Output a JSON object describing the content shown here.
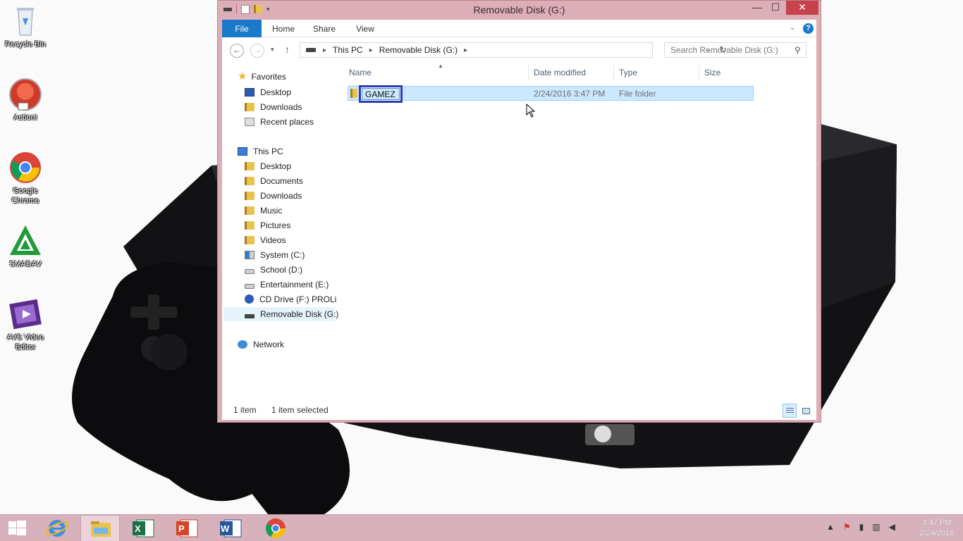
{
  "desktop": {
    "icons": [
      {
        "label": "Recycle Bin",
        "icon": "recycle-bin-icon"
      },
      {
        "label": "Action!",
        "icon": "action-icon"
      },
      {
        "label": "Google Chrome",
        "icon": "chrome-icon"
      },
      {
        "label": "SMADAV",
        "icon": "smadav-icon"
      },
      {
        "label": "AVS Video Editor",
        "icon": "avs-video-editor-icon"
      }
    ]
  },
  "window": {
    "title": "Removable Disk (G:)",
    "minimize": "—",
    "maximize": "☐",
    "close": "✕"
  },
  "ribbon": {
    "tabs": [
      "File",
      "Home",
      "Share",
      "View"
    ],
    "accent": "#1979ca"
  },
  "address": {
    "crumbs": [
      "This PC",
      "Removable Disk (G:)"
    ],
    "search_placeholder": "Search Removable Disk (G:)"
  },
  "navpane": {
    "favorites_label": "Favorites",
    "favorites": [
      {
        "label": "Desktop",
        "icon": "desktop"
      },
      {
        "label": "Downloads",
        "icon": "folder"
      },
      {
        "label": "Recent places",
        "icon": "recent"
      }
    ],
    "thispc_label": "This PC",
    "thispc": [
      {
        "label": "Desktop",
        "icon": "folder"
      },
      {
        "label": "Documents",
        "icon": "folder"
      },
      {
        "label": "Downloads",
        "icon": "folder"
      },
      {
        "label": "Music",
        "icon": "folder"
      },
      {
        "label": "Pictures",
        "icon": "folder"
      },
      {
        "label": "Videos",
        "icon": "folder"
      },
      {
        "label": "System (C:)",
        "icon": "sys"
      },
      {
        "label": "School (D:)",
        "icon": "drive"
      },
      {
        "label": "Entertainment (E:)",
        "icon": "drive"
      },
      {
        "label": "CD Drive (F:) PROLiN",
        "icon": "cd"
      },
      {
        "label": "Removable Disk (G:)",
        "icon": "usb",
        "selected": true
      }
    ],
    "network_label": "Network"
  },
  "list": {
    "columns": [
      "Name",
      "Date modified",
      "Type",
      "Size"
    ],
    "rows": [
      {
        "name": "GAMEZ",
        "date": "2/24/2016 3:47 PM",
        "type": "File folder",
        "size": "",
        "selected": true,
        "renaming": true
      }
    ]
  },
  "status": {
    "count": "1 item",
    "selected": "1 item selected"
  },
  "taskbar": {
    "apps": [
      "Start",
      "Internet Explorer",
      "File Explorer",
      "Excel",
      "PowerPoint",
      "Word",
      "Google Chrome"
    ],
    "active": "File Explorer",
    "time": "3:47 PM",
    "date": "2/24/2016"
  }
}
